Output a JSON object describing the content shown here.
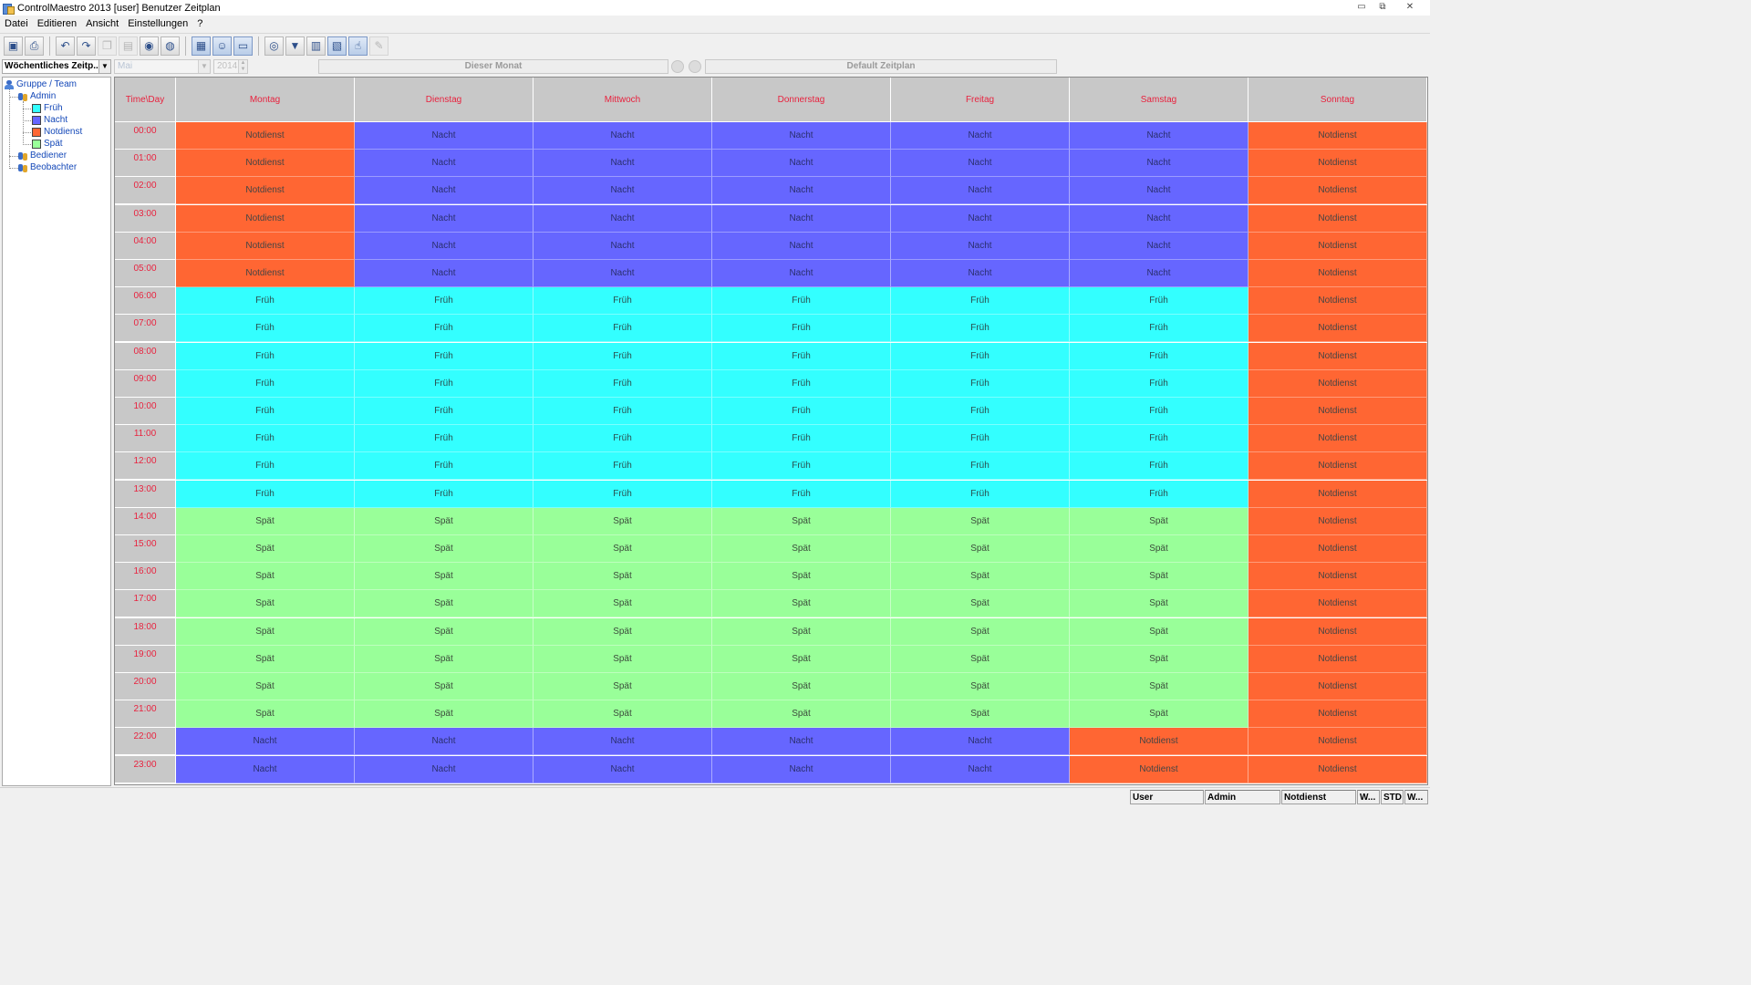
{
  "window": {
    "title": "ControlMaestro 2013 [user] Benutzer Zeitplan"
  },
  "menu": [
    "Datei",
    "Editieren",
    "Ansicht",
    "Einstellungen",
    "?"
  ],
  "toolbar": {
    "buttons": [
      {
        "name": "save-icon",
        "glyph": "▣",
        "state": "normal"
      },
      {
        "name": "print-icon",
        "glyph": "⎙",
        "state": "normal"
      },
      {
        "sep": true
      },
      {
        "name": "undo-icon",
        "glyph": "↶",
        "state": "normal"
      },
      {
        "name": "redo-icon",
        "glyph": "↷",
        "state": "normal"
      },
      {
        "name": "copy-icon",
        "glyph": "❐",
        "state": "disabled"
      },
      {
        "name": "paste-icon",
        "glyph": "▤",
        "state": "disabled"
      },
      {
        "name": "record-icon",
        "glyph": "◉",
        "state": "normal"
      },
      {
        "name": "stop-record-icon",
        "glyph": "◍",
        "state": "normal"
      },
      {
        "sep": true
      },
      {
        "name": "calendar-icon",
        "glyph": "▦",
        "state": "active"
      },
      {
        "name": "users-icon",
        "glyph": "☺",
        "state": "active"
      },
      {
        "name": "folder-icon",
        "glyph": "▭",
        "state": "active"
      },
      {
        "sep": true
      },
      {
        "name": "globe-icon",
        "glyph": "◎",
        "state": "normal"
      },
      {
        "name": "filter-icon",
        "glyph": "▼",
        "state": "normal"
      },
      {
        "name": "chart-icon",
        "glyph": "▥",
        "state": "normal"
      },
      {
        "name": "chart-edit-icon",
        "glyph": "▧",
        "state": "active"
      },
      {
        "name": "hand-icon",
        "glyph": "☝",
        "state": "active"
      },
      {
        "name": "pen-icon",
        "glyph": "✎",
        "state": "disabled"
      }
    ]
  },
  "filters": {
    "schedule_type": "Wöchentliches Zeitp...",
    "month": "Mai",
    "year": "2014",
    "this_month_label": "Dieser Monat",
    "default_schedule_label": "Default Zeitplan"
  },
  "tree": {
    "root": "Gruppe / Team",
    "groups": [
      {
        "label": "Admin",
        "children": [
          {
            "label": "Früh",
            "color": "#33ffff"
          },
          {
            "label": "Nacht",
            "color": "#6666ff"
          },
          {
            "label": "Notdienst",
            "color": "#ff6633"
          },
          {
            "label": "Spät",
            "color": "#99ff99"
          }
        ]
      },
      {
        "label": "Bediener",
        "children": []
      },
      {
        "label": "Beobachter",
        "children": []
      }
    ]
  },
  "schedule": {
    "corner_label": "Time\\Day",
    "days": [
      "Montag",
      "Dienstag",
      "Mittwoch",
      "Donnerstag",
      "Freitag",
      "Samstag",
      "Sonntag"
    ],
    "hours": [
      "00:00",
      "01:00",
      "02:00",
      "03:00",
      "04:00",
      "05:00",
      "06:00",
      "07:00",
      "08:00",
      "09:00",
      "10:00",
      "11:00",
      "12:00",
      "13:00",
      "14:00",
      "15:00",
      "16:00",
      "17:00",
      "18:00",
      "19:00",
      "20:00",
      "21:00",
      "22:00",
      "23:00"
    ],
    "shift_colors": {
      "Notdienst": {
        "bg": "#ff6633",
        "fg": "#444444"
      },
      "Nacht": {
        "bg": "#6666ff",
        "fg": "#2a2f6e"
      },
      "Früh": {
        "bg": "#33ffff",
        "fg": "#2a4f4f"
      },
      "Spät": {
        "bg": "#99ff99",
        "fg": "#3b4b3b"
      }
    },
    "cells": [
      [
        "Notdienst",
        "Nacht",
        "Nacht",
        "Nacht",
        "Nacht",
        "Nacht",
        "Notdienst"
      ],
      [
        "Notdienst",
        "Nacht",
        "Nacht",
        "Nacht",
        "Nacht",
        "Nacht",
        "Notdienst"
      ],
      [
        "Notdienst",
        "Nacht",
        "Nacht",
        "Nacht",
        "Nacht",
        "Nacht",
        "Notdienst"
      ],
      [
        "Notdienst",
        "Nacht",
        "Nacht",
        "Nacht",
        "Nacht",
        "Nacht",
        "Notdienst"
      ],
      [
        "Notdienst",
        "Nacht",
        "Nacht",
        "Nacht",
        "Nacht",
        "Nacht",
        "Notdienst"
      ],
      [
        "Notdienst",
        "Nacht",
        "Nacht",
        "Nacht",
        "Nacht",
        "Nacht",
        "Notdienst"
      ],
      [
        "Früh",
        "Früh",
        "Früh",
        "Früh",
        "Früh",
        "Früh",
        "Notdienst"
      ],
      [
        "Früh",
        "Früh",
        "Früh",
        "Früh",
        "Früh",
        "Früh",
        "Notdienst"
      ],
      [
        "Früh",
        "Früh",
        "Früh",
        "Früh",
        "Früh",
        "Früh",
        "Notdienst"
      ],
      [
        "Früh",
        "Früh",
        "Früh",
        "Früh",
        "Früh",
        "Früh",
        "Notdienst"
      ],
      [
        "Früh",
        "Früh",
        "Früh",
        "Früh",
        "Früh",
        "Früh",
        "Notdienst"
      ],
      [
        "Früh",
        "Früh",
        "Früh",
        "Früh",
        "Früh",
        "Früh",
        "Notdienst"
      ],
      [
        "Früh",
        "Früh",
        "Früh",
        "Früh",
        "Früh",
        "Früh",
        "Notdienst"
      ],
      [
        "Früh",
        "Früh",
        "Früh",
        "Früh",
        "Früh",
        "Früh",
        "Notdienst"
      ],
      [
        "Spät",
        "Spät",
        "Spät",
        "Spät",
        "Spät",
        "Spät",
        "Notdienst"
      ],
      [
        "Spät",
        "Spät",
        "Spät",
        "Spät",
        "Spät",
        "Spät",
        "Notdienst"
      ],
      [
        "Spät",
        "Spät",
        "Spät",
        "Spät",
        "Spät",
        "Spät",
        "Notdienst"
      ],
      [
        "Spät",
        "Spät",
        "Spät",
        "Spät",
        "Spät",
        "Spät",
        "Notdienst"
      ],
      [
        "Spät",
        "Spät",
        "Spät",
        "Spät",
        "Spät",
        "Spät",
        "Notdienst"
      ],
      [
        "Spät",
        "Spät",
        "Spät",
        "Spät",
        "Spät",
        "Spät",
        "Notdienst"
      ],
      [
        "Spät",
        "Spät",
        "Spät",
        "Spät",
        "Spät",
        "Spät",
        "Notdienst"
      ],
      [
        "Spät",
        "Spät",
        "Spät",
        "Spät",
        "Spät",
        "Spät",
        "Notdienst"
      ],
      [
        "Nacht",
        "Nacht",
        "Nacht",
        "Nacht",
        "Nacht",
        "Notdienst",
        "Notdienst"
      ],
      [
        "Nacht",
        "Nacht",
        "Nacht",
        "Nacht",
        "Nacht",
        "Notdienst",
        "Notdienst"
      ]
    ]
  },
  "statusbar": [
    "User",
    "Admin",
    "Notdienst",
    "W...",
    "STD",
    "W..."
  ]
}
